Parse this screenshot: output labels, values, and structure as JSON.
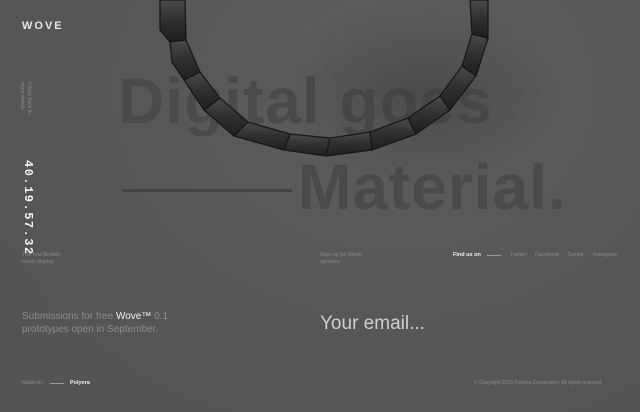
{
  "brand": {
    "logo": "WOVE"
  },
  "side_note": "Check back for more details.",
  "countdown": "40.19.57.32",
  "hero": {
    "line1": "Digital goes",
    "line2": "Material."
  },
  "tagline": "The first flexible touch display",
  "signup_note": "Sign up for Wove updates",
  "social": {
    "heading": "Find us on",
    "links": [
      "Twitter",
      "Facebook",
      "Tumblr",
      "Instagram"
    ]
  },
  "submission": {
    "prefix": "Submissions for free",
    "product": "Wove™",
    "version": "0.1",
    "suffix": "prototypes open in September."
  },
  "email": {
    "placeholder": "Your email..."
  },
  "footer": {
    "made_by": "Made by",
    "maker": "Polyera",
    "copyright": "© Copyright 2015 Polyera Corporation. All rights reserved."
  },
  "colors": {
    "background": "#5a5a5a",
    "accent_text": "#f0f0f0",
    "muted_text": "#8a8a8a"
  }
}
